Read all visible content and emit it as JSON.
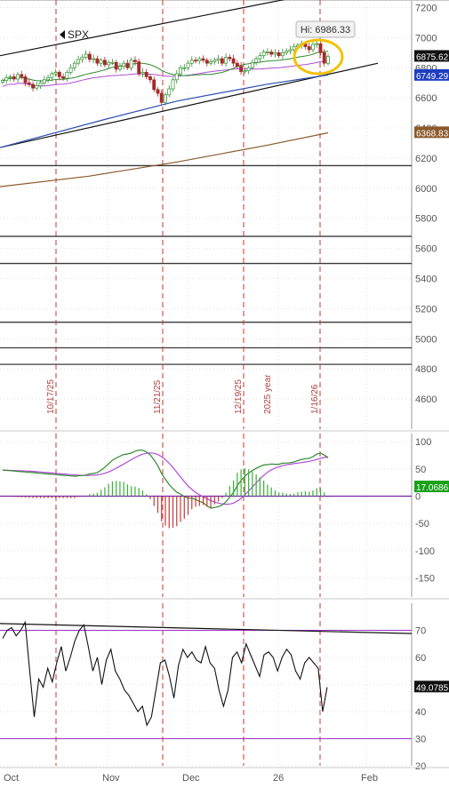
{
  "symbol": "SPX",
  "hi_label": "Hi: 6986.33",
  "colors": {
    "up": "#2f8f2f",
    "down": "#a52a2a",
    "ma_green": "#2e8b2e",
    "ma_violet": "#b04bd8",
    "ma_blue": "#2a4db0",
    "ma_brown": "#8b5a2b",
    "tag_black": "#111111",
    "tag_blue": "#1f3fbf",
    "tag_brown": "#8b5a2b",
    "tag_green": "#18a018",
    "highlight": "#f2c200",
    "event_line": "#c0392b"
  },
  "chart_data": [
    {
      "type": "line",
      "panel": "price",
      "ylim": [
        4400,
        7250
      ],
      "y_ticks": [
        4600,
        4800,
        5000,
        5200,
        5400,
        5600,
        5800,
        6000,
        6200,
        6400,
        6600,
        6800,
        7000,
        7200
      ],
      "price_tags": [
        {
          "value": "6875.62",
          "color": "tag_black"
        },
        {
          "value": "6749.29",
          "color": "tag_blue"
        },
        {
          "value": "6368.83",
          "color": "tag_brown"
        }
      ],
      "horizontal_levels": [
        6150,
        5680,
        5500,
        5110,
        4940,
        4830
      ],
      "event_dates": [
        "10/17/25",
        "11/21/25",
        "12/19/25",
        "1/16/26"
      ],
      "year_marker": "2025 year"
    },
    {
      "type": "line",
      "panel": "macd",
      "ylim": [
        -185,
        115
      ],
      "y_ticks": [
        100,
        50,
        0,
        -50,
        -100,
        -150
      ],
      "last_value": "17.0686"
    },
    {
      "type": "line",
      "panel": "rsi",
      "ylim": [
        20,
        80
      ],
      "y_ticks": [
        70,
        60,
        50,
        40,
        30,
        20
      ],
      "bands": [
        70,
        30
      ],
      "last_value": "49.0785"
    }
  ],
  "x_axis": {
    "labels": [
      "Oct",
      "Nov",
      "Dec",
      "26",
      "Feb"
    ]
  }
}
